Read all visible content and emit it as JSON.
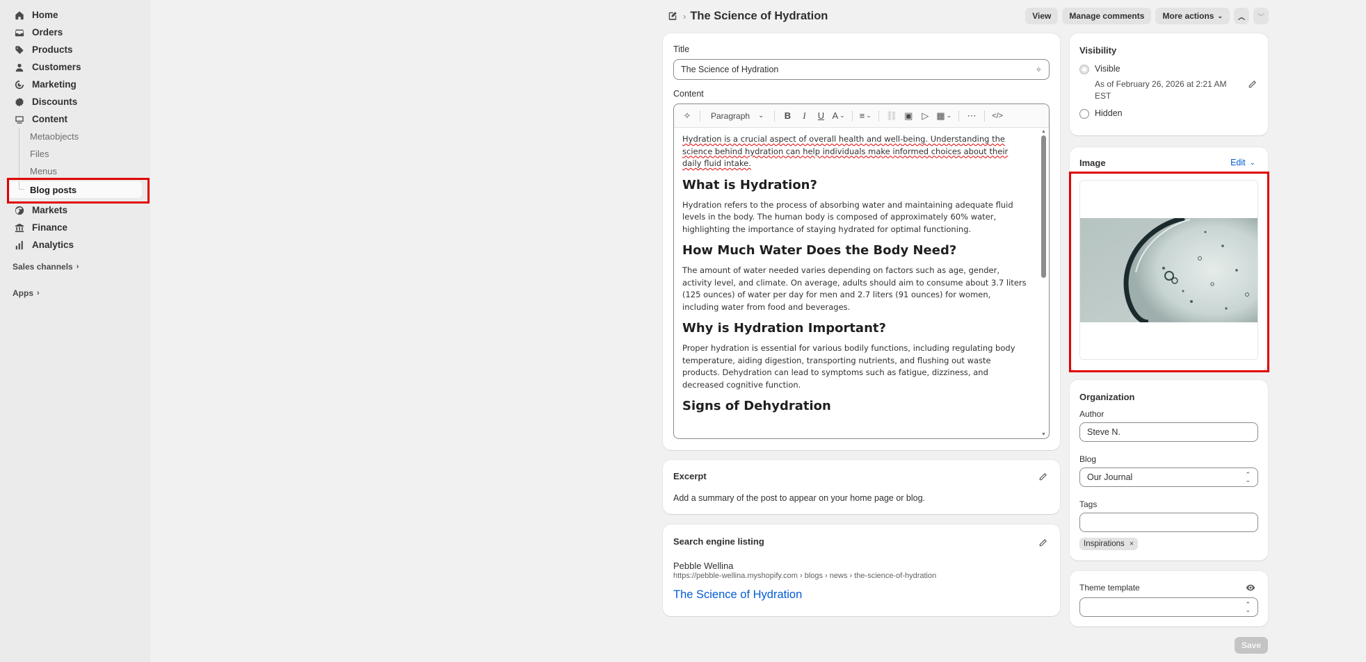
{
  "sidebar": {
    "items": [
      {
        "label": "Home",
        "icon": "home-icon"
      },
      {
        "label": "Orders",
        "icon": "inbox-icon"
      },
      {
        "label": "Products",
        "icon": "tag-icon"
      },
      {
        "label": "Customers",
        "icon": "person-icon"
      },
      {
        "label": "Marketing",
        "icon": "target-icon"
      },
      {
        "label": "Discounts",
        "icon": "discount-icon"
      },
      {
        "label": "Content",
        "icon": "content-icon"
      }
    ],
    "content_sub": [
      "Metaobjects",
      "Files",
      "Menus",
      "Blog posts"
    ],
    "items2": [
      {
        "label": "Markets",
        "icon": "globe-icon"
      },
      {
        "label": "Finance",
        "icon": "bank-icon"
      },
      {
        "label": "Analytics",
        "icon": "chart-icon"
      }
    ],
    "sales_channels": "Sales channels",
    "apps": "Apps"
  },
  "header": {
    "title": "The Science of Hydration",
    "view": "View",
    "manage_comments": "Manage comments",
    "more_actions": "More actions"
  },
  "editor": {
    "title_label": "Title",
    "title_value": "The Science of Hydration",
    "content_label": "Content",
    "paragraph_select": "Paragraph",
    "body": {
      "p1": "Hydration is a crucial aspect of overall health and well-being. Understanding the science behind hydration can help individuals make informed choices about their daily fluid intake.",
      "h1": "What is Hydration?",
      "p2": "Hydration refers to the process of absorbing water and maintaining adequate fluid levels in the body. The human body is composed of approximately 60% water, highlighting the importance of staying hydrated for optimal functioning.",
      "h2": "How Much Water Does the Body Need?",
      "p3": "The amount of water needed varies depending on factors such as age, gender, activity level, and climate. On average, adults should aim to consume about 3.7 liters (125 ounces) of water per day for men and 2.7 liters (91 ounces) for women, including water from food and beverages.",
      "h3": "Why is Hydration Important?",
      "p4": "Proper hydration is essential for various bodily functions, including regulating body temperature, aiding digestion, transporting nutrients, and flushing out waste products. Dehydration can lead to symptoms such as fatigue, dizziness, and decreased cognitive function.",
      "h4": "Signs of Dehydration"
    }
  },
  "excerpt": {
    "title": "Excerpt",
    "text": "Add a summary of the post to appear on your home page or blog."
  },
  "seo": {
    "title": "Search engine listing",
    "store": "Pebble Wellina",
    "url": "https://pebble-wellina.myshopify.com › blogs › news › the-science-of-hydration",
    "link": "The Science of Hydration",
    "link_color": "#005bd3"
  },
  "visibility": {
    "title": "Visibility",
    "visible": "Visible",
    "as_of": "As of February 26, 2026 at 2:21 AM EST",
    "hidden": "Hidden"
  },
  "image": {
    "title": "Image",
    "edit": "Edit"
  },
  "organization": {
    "title": "Organization",
    "author_label": "Author",
    "author_value": "Steve N.",
    "blog_label": "Blog",
    "blog_value": "Our Journal",
    "tags_label": "Tags",
    "tag": "Inspirations"
  },
  "theme": {
    "title": "Theme template"
  },
  "save": "Save",
  "colors": {
    "highlight": "#e00000",
    "link": "#005bd3"
  }
}
